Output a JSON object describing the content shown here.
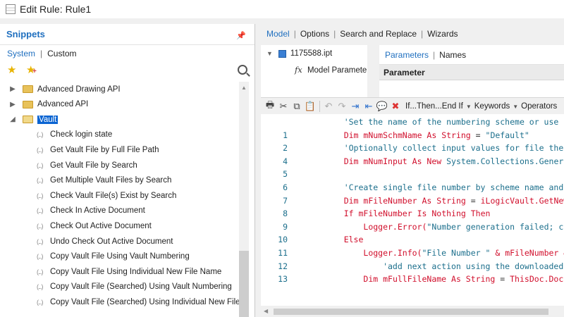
{
  "window": {
    "title": "Edit Rule: Rule1"
  },
  "snippets": {
    "title": "Snippets",
    "pin_icon": "pin-icon",
    "tabs": [
      {
        "label": "System",
        "active": true
      },
      {
        "label": "Custom",
        "active": false
      }
    ],
    "toolbar_icons": [
      "favorite-star-icon",
      "add-favorite-icon",
      "search-icon"
    ],
    "tree": [
      {
        "label": "Advanced Drawing API",
        "type": "folder",
        "expanded": false
      },
      {
        "label": "Advanced API",
        "type": "folder",
        "expanded": false
      },
      {
        "label": "Vault",
        "type": "folder",
        "expanded": true,
        "selected": true
      },
      {
        "label": "Check login state",
        "type": "snippet"
      },
      {
        "label": "Get Vault File by Full File Path",
        "type": "snippet"
      },
      {
        "label": "Get Vault File by Search",
        "type": "snippet"
      },
      {
        "label": "Get Multiple Vault Files by Search",
        "type": "snippet"
      },
      {
        "label": "Check Vault File(s) Exist by Search",
        "type": "snippet"
      },
      {
        "label": "Check In Active Document",
        "type": "snippet"
      },
      {
        "label": "Check Out Active Document",
        "type": "snippet"
      },
      {
        "label": "Undo Check Out Active Document",
        "type": "snippet"
      },
      {
        "label": "Copy Vault File Using Vault Numbering",
        "type": "snippet"
      },
      {
        "label": "Copy Vault File Using Individual New File Name",
        "type": "snippet"
      },
      {
        "label": "Copy Vault File (Searched) Using Vault Numbering",
        "type": "snippet"
      },
      {
        "label": "Copy Vault File (Searched) Using Individual New File Na",
        "type": "snippet"
      }
    ],
    "snippet_glyph": "(...)"
  },
  "main_tabs": [
    {
      "label": "Model",
      "active": true
    },
    {
      "label": "Options",
      "active": false
    },
    {
      "label": "Search and Replace",
      "active": false
    },
    {
      "label": "Wizards",
      "active": false
    }
  ],
  "model_tree": {
    "root": "1175588.ipt",
    "child_prefix": "fx",
    "child": "Model Paramete"
  },
  "params": {
    "tabs": [
      {
        "label": "Parameters",
        "active": true
      },
      {
        "label": "Names",
        "active": false
      }
    ],
    "column_header": "Parameter"
  },
  "editor_toolbar": {
    "icons": [
      "print-icon",
      "cut-icon",
      "copy-icon",
      "paste-icon",
      "undo-icon",
      "redo-icon",
      "indent-icon",
      "outdent-icon",
      "comment-icon",
      "uncomment-icon"
    ],
    "if_label": "If...Then...End If",
    "keywords_label": "Keywords",
    "operators_label": "Operators"
  },
  "code_lines": [
    {
      "n": "",
      "parts": [
        {
          "t": "    'Set the name of the numbering scheme or use 'D",
          "c": "cmt"
        }
      ]
    },
    {
      "n": "1",
      "parts": [
        {
          "t": "    ",
          "c": "plain"
        },
        {
          "t": "Dim",
          "c": "kw"
        },
        {
          "t": " mNumSchmName ",
          "c": "kw"
        },
        {
          "t": "As String",
          "c": "kw"
        },
        {
          "t": " = ",
          "c": "plain"
        },
        {
          "t": "\"Default\"",
          "c": "str"
        }
      ]
    },
    {
      "n": "2",
      "parts": [
        {
          "t": "    'Optionally collect input values for file the s",
          "c": "cmt"
        }
      ]
    },
    {
      "n": "4",
      "parts": [
        {
          "t": "    ",
          "c": "plain"
        },
        {
          "t": "Dim",
          "c": "kw"
        },
        {
          "t": " mNumInput ",
          "c": "kw"
        },
        {
          "t": "As New",
          "c": "kw"
        },
        {
          "t": " System.Collections.Generic",
          "c": "cls"
        }
      ]
    },
    {
      "n": "5",
      "parts": [
        {
          "t": "",
          "c": "plain"
        }
      ]
    },
    {
      "n": "6",
      "parts": [
        {
          "t": "    'Create single file number by scheme name and c",
          "c": "cmt"
        }
      ]
    },
    {
      "n": "7",
      "parts": [
        {
          "t": "    ",
          "c": "plain"
        },
        {
          "t": "Dim",
          "c": "kw"
        },
        {
          "t": " mFileNumber ",
          "c": "kw"
        },
        {
          "t": "As String",
          "c": "kw"
        },
        {
          "t": " = ",
          "c": "plain"
        },
        {
          "t": "iLogicVault.GetNewN",
          "c": "kw"
        }
      ]
    },
    {
      "n": "8",
      "parts": [
        {
          "t": "    ",
          "c": "plain"
        },
        {
          "t": "If",
          "c": "kw"
        },
        {
          "t": " mFileNumber ",
          "c": "kw"
        },
        {
          "t": "Is Nothing Then",
          "c": "kw"
        }
      ]
    },
    {
      "n": "9",
      "parts": [
        {
          "t": "        ",
          "c": "plain"
        },
        {
          "t": "Logger.Error(",
          "c": "kw"
        },
        {
          "t": "\"Number generation failed; che",
          "c": "str"
        }
      ]
    },
    {
      "n": "10",
      "parts": [
        {
          "t": "    ",
          "c": "plain"
        },
        {
          "t": "Else",
          "c": "kw"
        }
      ]
    },
    {
      "n": "11",
      "parts": [
        {
          "t": "        ",
          "c": "plain"
        },
        {
          "t": "Logger.Info(",
          "c": "kw"
        },
        {
          "t": "\"File Number \"",
          "c": "str"
        },
        {
          "t": " & mFileNumber &",
          "c": "kw"
        }
      ]
    },
    {
      "n": "12",
      "parts": [
        {
          "t": "            'add next action using the downloaded f",
          "c": "cmt"
        }
      ]
    },
    {
      "n": "13",
      "parts": [
        {
          "t": "        ",
          "c": "plain"
        },
        {
          "t": "Dim",
          "c": "kw"
        },
        {
          "t": " mFullFileName ",
          "c": "kw"
        },
        {
          "t": "As String",
          "c": "kw"
        },
        {
          "t": " = ",
          "c": "plain"
        },
        {
          "t": "ThisDoc.Docum",
          "c": "kw"
        }
      ]
    }
  ]
}
